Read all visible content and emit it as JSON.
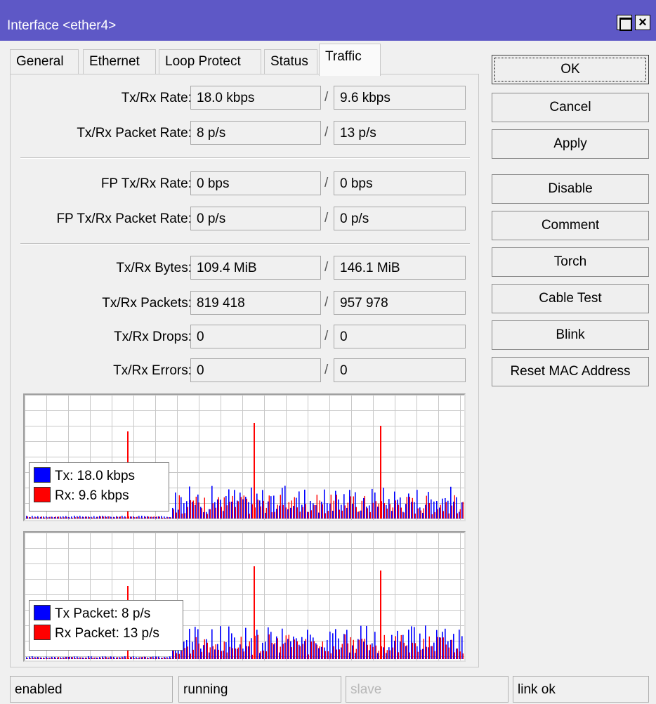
{
  "window": {
    "title": "Interface <ether4>"
  },
  "tabs": [
    {
      "label": "General"
    },
    {
      "label": "Ethernet"
    },
    {
      "label": "Loop Protect"
    },
    {
      "label": "Status"
    },
    {
      "label": "Traffic",
      "active": true
    }
  ],
  "fields": [
    {
      "label": "Tx/Rx Rate:",
      "tx": "18.0 kbps",
      "rx": "9.6 kbps"
    },
    {
      "label": "Tx/Rx Packet Rate:",
      "tx": "8 p/s",
      "rx": "13 p/s"
    },
    {
      "label": "FP Tx/Rx Rate:",
      "tx": "0 bps",
      "rx": "0 bps"
    },
    {
      "label": "FP Tx/Rx Packet Rate:",
      "tx": "0 p/s",
      "rx": "0 p/s"
    },
    {
      "label": "Tx/Rx Bytes:",
      "tx": "109.4 MiB",
      "rx": "146.1 MiB"
    },
    {
      "label": "Tx/Rx Packets:",
      "tx": "819 418",
      "rx": "957 978"
    },
    {
      "label": "Tx/Rx Drops:",
      "tx": "0",
      "rx": "0"
    },
    {
      "label": "Tx/Rx Errors:",
      "tx": "0",
      "rx": "0"
    }
  ],
  "separator": "/",
  "graphs": {
    "rate": {
      "tx_legend": "Tx:  18.0 kbps",
      "rx_legend": "Rx:  9.6 kbps"
    },
    "packets": {
      "tx_legend": "Tx Packet:  8 p/s",
      "rx_legend": "Rx Packet:  13 p/s"
    }
  },
  "colors": {
    "tx": "#0000ff",
    "rx": "#ff0000",
    "grid": "#c8c8c8"
  },
  "buttons": {
    "ok": "OK",
    "cancel": "Cancel",
    "apply": "Apply",
    "disable": "Disable",
    "comment": "Comment",
    "torch": "Torch",
    "cable_test": "Cable Test",
    "blink": "Blink",
    "reset_mac": "Reset MAC Address"
  },
  "status_bar": {
    "enabled": "enabled",
    "running": "running",
    "slave": "slave",
    "link": "link ok"
  }
}
